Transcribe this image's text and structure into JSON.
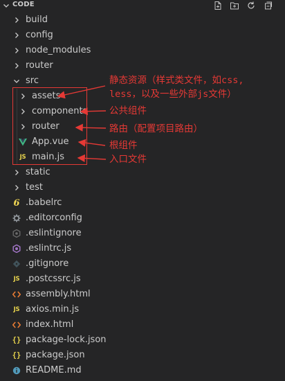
{
  "explorer": {
    "title": "CODE",
    "actions": [
      {
        "name": "new-file-icon"
      },
      {
        "name": "new-folder-icon"
      },
      {
        "name": "refresh-icon"
      },
      {
        "name": "collapse-all-icon"
      }
    ]
  },
  "tree": [
    {
      "label": "build",
      "type": "folder",
      "depth": 0
    },
    {
      "label": "config",
      "type": "folder",
      "depth": 0
    },
    {
      "label": "node_modules",
      "type": "folder",
      "depth": 0
    },
    {
      "label": "router",
      "type": "folder",
      "depth": 0
    },
    {
      "label": "src",
      "type": "folder-open",
      "depth": 0
    },
    {
      "label": "assets",
      "type": "folder",
      "depth": 1
    },
    {
      "label": "components",
      "type": "folder",
      "depth": 1
    },
    {
      "label": "router",
      "type": "folder",
      "depth": 1
    },
    {
      "label": "App.vue",
      "type": "vue",
      "depth": 1
    },
    {
      "label": "main.js",
      "type": "js",
      "depth": 1
    },
    {
      "label": "static",
      "type": "folder",
      "depth": 0
    },
    {
      "label": "test",
      "type": "folder",
      "depth": 0
    },
    {
      "label": ".babelrc",
      "type": "babel",
      "depth": 0
    },
    {
      "label": ".editorconfig",
      "type": "gear",
      "depth": 0
    },
    {
      "label": ".eslintignore",
      "type": "eslint",
      "depth": 0
    },
    {
      "label": ".eslintrc.js",
      "type": "eslint-purple",
      "depth": 0
    },
    {
      "label": ".gitignore",
      "type": "git",
      "depth": 0
    },
    {
      "label": ".postcssrc.js",
      "type": "js",
      "depth": 0
    },
    {
      "label": "assembly.html",
      "type": "html",
      "depth": 0
    },
    {
      "label": "axios.min.js",
      "type": "js",
      "depth": 0
    },
    {
      "label": "index.html",
      "type": "html",
      "depth": 0
    },
    {
      "label": "package-lock.json",
      "type": "json",
      "depth": 0
    },
    {
      "label": "package.json",
      "type": "json",
      "depth": 0
    },
    {
      "label": "README.md",
      "type": "md",
      "depth": 0
    }
  ],
  "annotations": {
    "assets_line1": "静态资源（样式类文件，如css,",
    "assets_line2": "less，以及一些外部js文件）",
    "components": "公共组件",
    "router": "路由（配置项目路由）",
    "app": "根组件",
    "main": "入口文件"
  },
  "colors": {
    "background": "#252526",
    "text": "#cccccc",
    "annotation": "#e53935",
    "js_badge": "#e8d44d",
    "vue_green": "#41b883",
    "html_orange": "#e37933",
    "eslint_purple": "#a074c4"
  }
}
